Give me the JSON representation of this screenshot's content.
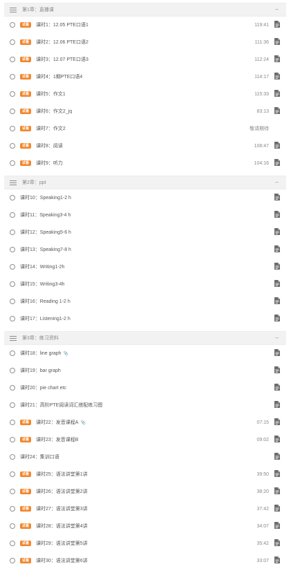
{
  "badge_label": "试看",
  "colors": {
    "badge": "#f0872d",
    "chapter_bg": "#f2f2f2"
  },
  "icons": {
    "chapter": "list-lines-icon",
    "collapse": "minus-icon",
    "lesson": "radio-circle-icon",
    "file": "document-icon",
    "attachment": "paperclip-icon"
  },
  "chapters": [
    {
      "title": "第1章：直播课",
      "collapse": "–",
      "lessons": [
        {
          "title": "课时1：12.05 PTE口语1",
          "badge": true,
          "duration": "119:41",
          "file": true
        },
        {
          "title": "课时2：12.06 PTE口语2",
          "badge": true,
          "duration": "111:36",
          "file": true
        },
        {
          "title": "课时3：12.07 PTE口语3",
          "badge": true,
          "duration": "112:24",
          "file": true
        },
        {
          "title": "课时4：1期PTE口语4",
          "badge": true,
          "duration": "114:17",
          "file": true
        },
        {
          "title": "课时5：作文1",
          "badge": true,
          "duration": "115:33",
          "file": true
        },
        {
          "title": "课时6：作文2_jq",
          "badge": true,
          "duration": "83:13",
          "file": true
        },
        {
          "title": "课时7：作文2",
          "badge": true,
          "duration": "敬请期待",
          "file": false
        },
        {
          "title": "课时8：阅读",
          "badge": true,
          "duration": "108:47",
          "file": true
        },
        {
          "title": "课时9：听力",
          "badge": true,
          "duration": "104:16",
          "file": true
        }
      ]
    },
    {
      "title": "第2章：ppt",
      "collapse": "–",
      "lessons": [
        {
          "title": "课时10：Speaking1-2 h",
          "badge": false,
          "duration": "",
          "file": true
        },
        {
          "title": "课时11：Speaking3-4 h",
          "badge": false,
          "duration": "",
          "file": true
        },
        {
          "title": "课时12：Speaking5-6 h",
          "badge": false,
          "duration": "",
          "file": true
        },
        {
          "title": "课时13：Speaking7-8 h",
          "badge": false,
          "duration": "",
          "file": true
        },
        {
          "title": "课时14：Writing1-2h",
          "badge": false,
          "duration": "",
          "file": true
        },
        {
          "title": "课时15：Writing3-4h",
          "badge": false,
          "duration": "",
          "file": true
        },
        {
          "title": "课时16：Reading 1-2 h",
          "badge": false,
          "duration": "",
          "file": true
        },
        {
          "title": "课时17：Listening1-2 h",
          "badge": false,
          "duration": "",
          "file": true
        }
      ]
    },
    {
      "title": "第3章：练习资料",
      "collapse": "–",
      "lessons": [
        {
          "title": "课时18：line graph",
          "badge": false,
          "duration": "",
          "file": true,
          "clip": true
        },
        {
          "title": "课时19：bar graph",
          "badge": false,
          "duration": "",
          "file": true
        },
        {
          "title": "课时20：pie chart etc",
          "badge": false,
          "duration": "",
          "file": true
        },
        {
          "title": "课时21：高阶PTE阅读词汇搭配练习图",
          "badge": false,
          "duration": "",
          "file": true
        },
        {
          "title": "课时22：发音课程A",
          "badge": true,
          "duration": "07:15",
          "file": true,
          "clip": true
        },
        {
          "title": "课时23：发音课程B",
          "badge": true,
          "duration": "09:02",
          "file": true
        },
        {
          "title": "课时24：集训口语",
          "badge": false,
          "duration": "",
          "file": true
        },
        {
          "title": "课时25：语法讲堂第1讲",
          "badge": true,
          "duration": "39:50",
          "file": true
        },
        {
          "title": "课时26：语法讲堂第2讲",
          "badge": true,
          "duration": "38:20",
          "file": true
        },
        {
          "title": "课时27：语法讲堂第3讲",
          "badge": true,
          "duration": "37:42",
          "file": true
        },
        {
          "title": "课时28：语法讲堂第4讲",
          "badge": true,
          "duration": "34:07",
          "file": true
        },
        {
          "title": "课时29：语法讲堂第5讲",
          "badge": true,
          "duration": "35:42",
          "file": true
        },
        {
          "title": "课时30：语法讲堂第6讲",
          "badge": true,
          "duration": "33:07",
          "file": true
        }
      ]
    }
  ]
}
